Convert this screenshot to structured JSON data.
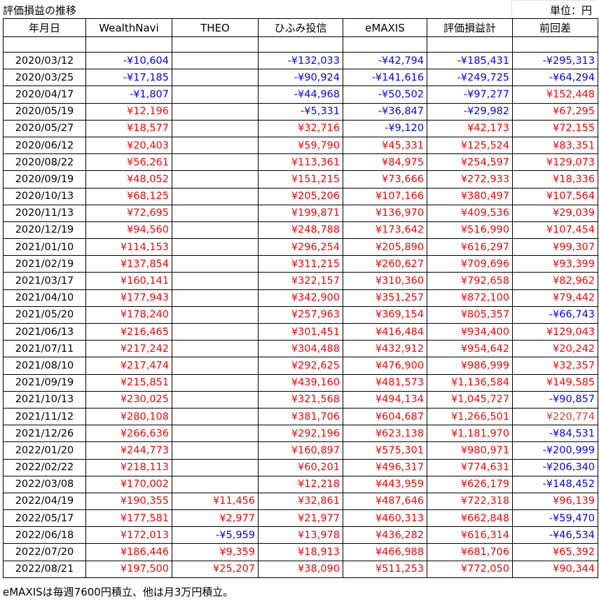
{
  "title": "評価損益の推移",
  "unit": "単位：円",
  "headers": [
    "年月日",
    "WealthNavi",
    "THEO",
    "ひふみ投信",
    "eMAXIS",
    "評価損益計",
    "前回差"
  ],
  "rows": [
    [
      "2020/03/12",
      "-¥10,604",
      "",
      "-¥132,033",
      "-¥42,794",
      "-¥185,431",
      "-¥295,313"
    ],
    [
      "2020/03/25",
      "-¥17,185",
      "",
      "-¥90,924",
      "-¥141,616",
      "-¥249,725",
      "-¥64,294"
    ],
    [
      "2020/04/17",
      "-¥1,807",
      "",
      "-¥44,968",
      "-¥50,502",
      "-¥97,277",
      "¥152,448"
    ],
    [
      "2020/05/19",
      "¥12,196",
      "",
      "-¥5,331",
      "-¥36,847",
      "-¥29,982",
      "¥67,295"
    ],
    [
      "2020/05/27",
      "¥18,577",
      "",
      "¥32,716",
      "-¥9,120",
      "¥42,173",
      "¥72,155"
    ],
    [
      "2020/06/12",
      "¥20,403",
      "",
      "¥59,790",
      "¥45,331",
      "¥125,524",
      "¥83,351"
    ],
    [
      "2020/08/22",
      "¥56,261",
      "",
      "¥113,361",
      "¥84,975",
      "¥254,597",
      "¥129,073"
    ],
    [
      "2020/09/19",
      "¥48,052",
      "",
      "¥151,215",
      "¥73,666",
      "¥272,933",
      "¥18,336"
    ],
    [
      "2020/10/13",
      "¥68,125",
      "",
      "¥205,206",
      "¥107,166",
      "¥380,497",
      "¥107,564"
    ],
    [
      "2020/11/13",
      "¥72,695",
      "",
      "¥199,871",
      "¥136,970",
      "¥409,536",
      "¥29,039"
    ],
    [
      "2020/12/19",
      "¥94,560",
      "",
      "¥248,788",
      "¥173,642",
      "¥516,990",
      "¥107,454"
    ],
    [
      "2021/01/10",
      "¥114,153",
      "",
      "¥296,254",
      "¥205,890",
      "¥616,297",
      "¥99,307"
    ],
    [
      "2021/02/19",
      "¥137,854",
      "",
      "¥311,215",
      "¥260,627",
      "¥709,696",
      "¥93,399"
    ],
    [
      "2021/03/17",
      "¥160,141",
      "",
      "¥322,157",
      "¥310,360",
      "¥792,658",
      "¥82,962"
    ],
    [
      "2021/04/10",
      "¥177,943",
      "",
      "¥342,900",
      "¥351,257",
      "¥872,100",
      "¥79,442"
    ],
    [
      "2021/05/20",
      "¥178,240",
      "",
      "¥257,963",
      "¥369,154",
      "¥805,357",
      "-¥66,743"
    ],
    [
      "2021/06/13",
      "¥216,465",
      "",
      "¥301,451",
      "¥416,484",
      "¥934,400",
      "¥129,043"
    ],
    [
      "2021/07/11",
      "¥217,242",
      "",
      "¥304,488",
      "¥432,912",
      "¥954,642",
      "¥20,242"
    ],
    [
      "2021/08/10",
      "¥217,474",
      "",
      "¥292,625",
      "¥476,900",
      "¥986,999",
      "¥32,357"
    ],
    [
      "2021/09/19",
      "¥215,851",
      "",
      "¥439,160",
      "¥481,573",
      "¥1,136,584",
      "¥149,585"
    ],
    [
      "2021/10/13",
      "¥230,025",
      "",
      "¥321,568",
      "¥494,134",
      "¥1,045,727",
      "-¥90,857"
    ],
    [
      "2021/11/12",
      "¥280,108",
      "",
      "¥381,706",
      "¥604,687",
      "¥1,266,501",
      "¥220,774"
    ],
    [
      "2021/12/26",
      "¥266,636",
      "",
      "¥292,196",
      "¥623,138",
      "¥1,181,970",
      "-¥84,531"
    ],
    [
      "2022/01/20",
      "¥244,773",
      "",
      "¥160,897",
      "¥575,301",
      "¥980,971",
      "-¥200,999"
    ],
    [
      "2022/02/22",
      "¥218,113",
      "",
      "¥60,201",
      "¥496,317",
      "¥774,631",
      "-¥206,340"
    ],
    [
      "2022/03/08",
      "¥170,002",
      "",
      "¥12,218",
      "¥443,959",
      "¥626,179",
      "-¥148,452"
    ],
    [
      "2022/04/19",
      "¥190,355",
      "¥11,456",
      "¥32,861",
      "¥487,646",
      "¥722,318",
      "¥96,139"
    ],
    [
      "2022/05/17",
      "¥177,581",
      "¥2,977",
      "¥21,977",
      "¥460,313",
      "¥662,848",
      "-¥59,470"
    ],
    [
      "2022/06/18",
      "¥172,013",
      "-¥5,959",
      "¥13,978",
      "¥436,282",
      "¥616,314",
      "-¥46,534"
    ],
    [
      "2022/07/20",
      "¥186,446",
      "¥9,359",
      "¥18,913",
      "¥466,988",
      "¥681,706",
      "¥65,392"
    ],
    [
      "2022/08/21",
      "¥197,500",
      "¥25,207",
      "¥38,090",
      "¥511,253",
      "¥772,050",
      "¥90,344"
    ]
  ],
  "footnote": "eMAXISは毎週7600円積立、他は月3万円積立。",
  "colors": {
    "negative": "#0000ff",
    "positive": "#ff0000",
    "highlight": "#e0401a"
  }
}
